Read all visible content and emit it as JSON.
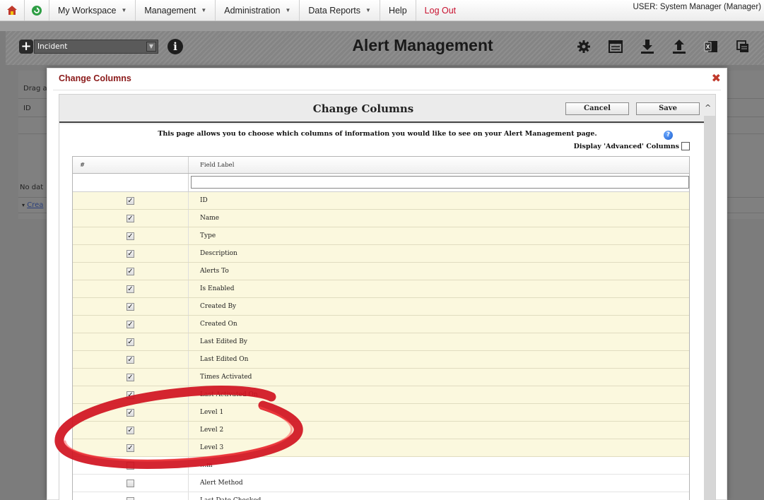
{
  "nav": {
    "items": [
      {
        "label": "My Workspace",
        "caret": true
      },
      {
        "label": "Management",
        "caret": true
      },
      {
        "label": "Administration",
        "caret": true
      },
      {
        "label": "Data Reports",
        "caret": true
      },
      {
        "label": "Help",
        "caret": false
      }
    ],
    "logout": "Log Out",
    "user": "USER: System Manager (Manager)"
  },
  "toolbar": {
    "type_select": "Incident",
    "title": "Alert Management",
    "icons": [
      "gear-icon",
      "table-icon",
      "download-icon",
      "upload-icon",
      "excel-icon",
      "print-icon"
    ]
  },
  "background": {
    "drag_text": "Drag a",
    "id_header": "ID",
    "no_data": "No dat",
    "create_link": "Crea"
  },
  "modal": {
    "title": "Change Columns",
    "header_title": "Change Columns",
    "cancel": "Cancel",
    "save": "Save",
    "description": "This page allows you to choose which columns of information you would like to see on your Alert Management page.",
    "advanced_label": "Display 'Advanced' Columns",
    "grid": {
      "col_num": "#",
      "col_label": "Field Label",
      "filter_value": "",
      "rows": [
        {
          "label": "ID",
          "checked": true
        },
        {
          "label": "Name",
          "checked": true
        },
        {
          "label": "Type",
          "checked": true
        },
        {
          "label": "Description",
          "checked": true
        },
        {
          "label": "Alerts To",
          "checked": true
        },
        {
          "label": "Is Enabled",
          "checked": true
        },
        {
          "label": "Created By",
          "checked": true
        },
        {
          "label": "Created On",
          "checked": true
        },
        {
          "label": "Last Edited By",
          "checked": true
        },
        {
          "label": "Last Edited On",
          "checked": true
        },
        {
          "label": "Times Activated",
          "checked": true
        },
        {
          "label": "Last Activated On",
          "checked": true
        },
        {
          "label": "Level 1",
          "checked": true
        },
        {
          "label": "Level 2",
          "checked": true
        },
        {
          "label": "Level 3",
          "checked": true
        },
        {
          "label": "…m",
          "checked": false
        },
        {
          "label": "Alert Method",
          "checked": false
        },
        {
          "label": "Last Date Checked",
          "checked": false
        }
      ]
    }
  },
  "colors": {
    "logout": "#c8102e",
    "modal_title": "#8b1a1a",
    "row_checked": "#fbf8de",
    "annotation": "#d0121f"
  }
}
